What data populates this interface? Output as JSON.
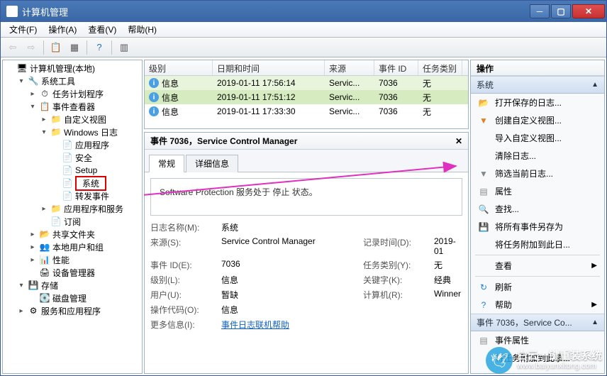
{
  "title": "计算机管理",
  "menu": [
    "文件(F)",
    "操作(A)",
    "查看(V)",
    "帮助(H)"
  ],
  "tree": [
    {
      "d": 0,
      "tw": "",
      "ic": "🖥",
      "lbl": "计算机管理(本地)"
    },
    {
      "d": 1,
      "tw": "▾",
      "ic": "🔧",
      "lbl": "系统工具"
    },
    {
      "d": 2,
      "tw": "▸",
      "ic": "⏱",
      "lbl": "任务计划程序"
    },
    {
      "d": 2,
      "tw": "▾",
      "ic": "📋",
      "lbl": "事件查看器"
    },
    {
      "d": 3,
      "tw": "▸",
      "ic": "📁",
      "lbl": "自定义视图"
    },
    {
      "d": 3,
      "tw": "▾",
      "ic": "📁",
      "lbl": "Windows 日志"
    },
    {
      "d": 4,
      "tw": "",
      "ic": "📄",
      "lbl": "应用程序"
    },
    {
      "d": 4,
      "tw": "",
      "ic": "📄",
      "lbl": "安全"
    },
    {
      "d": 4,
      "tw": "",
      "ic": "📄",
      "lbl": "Setup"
    },
    {
      "d": 4,
      "tw": "",
      "ic": "📄",
      "lbl": "系统",
      "hl": true
    },
    {
      "d": 4,
      "tw": "",
      "ic": "📄",
      "lbl": "转发事件"
    },
    {
      "d": 3,
      "tw": "▸",
      "ic": "📁",
      "lbl": "应用程序和服务"
    },
    {
      "d": 3,
      "tw": "",
      "ic": "📄",
      "lbl": "订阅"
    },
    {
      "d": 2,
      "tw": "▸",
      "ic": "📂",
      "lbl": "共享文件夹"
    },
    {
      "d": 2,
      "tw": "▸",
      "ic": "👥",
      "lbl": "本地用户和组"
    },
    {
      "d": 2,
      "tw": "▸",
      "ic": "📊",
      "lbl": "性能"
    },
    {
      "d": 2,
      "tw": "",
      "ic": "🖨",
      "lbl": "设备管理器"
    },
    {
      "d": 1,
      "tw": "▾",
      "ic": "💾",
      "lbl": "存储"
    },
    {
      "d": 2,
      "tw": "",
      "ic": "💽",
      "lbl": "磁盘管理"
    },
    {
      "d": 1,
      "tw": "▸",
      "ic": "⚙",
      "lbl": "服务和应用程序"
    }
  ],
  "list": {
    "headers": [
      "级别",
      "日期和时间",
      "来源",
      "事件 ID",
      "任务类别"
    ],
    "widths": [
      96,
      158,
      70,
      62,
      62
    ],
    "rows": [
      {
        "lvl": "信息",
        "dt": "2019-01-11 17:56:14",
        "src": "Servic...",
        "id": "7036",
        "cat": "无",
        "sel": false
      },
      {
        "lvl": "信息",
        "dt": "2019-01-11 17:51:12",
        "src": "Servic...",
        "id": "7036",
        "cat": "无",
        "sel": true
      },
      {
        "lvl": "信息",
        "dt": "2019-01-11 17:33:30",
        "src": "Servic...",
        "id": "7036",
        "cat": "无",
        "sel": false
      }
    ]
  },
  "detail": {
    "title": "事件 7036，Service Control Manager",
    "tabs": [
      "常规",
      "详细信息"
    ],
    "message": "Software Protection 服务处于 停止 状态。",
    "fields": [
      {
        "k": "日志名称(M):",
        "v": "系统",
        "k2": "",
        "v2": ""
      },
      {
        "k": "来源(S):",
        "v": "Service Control Manager",
        "k2": "记录时间(D):",
        "v2": "2019-01"
      },
      {
        "k": "事件 ID(E):",
        "v": "7036",
        "k2": "任务类别(Y):",
        "v2": "无"
      },
      {
        "k": "级别(L):",
        "v": "信息",
        "k2": "关键字(K):",
        "v2": "经典"
      },
      {
        "k": "用户(U):",
        "v": "暂缺",
        "k2": "计算机(R):",
        "v2": "Winner"
      },
      {
        "k": "操作代码(O):",
        "v": "信息",
        "k2": "",
        "v2": ""
      }
    ],
    "more_label": "更多信息(I):",
    "more_link": "事件日志联机帮助"
  },
  "actions": {
    "title": "操作",
    "section1": "系统",
    "items1": [
      {
        "ic": "📂",
        "lbl": "打开保存的日志..."
      },
      {
        "ic": "▼",
        "lbl": "创建自定义视图...",
        "col": "#e08020"
      },
      {
        "ic": "",
        "lbl": "导入自定义视图..."
      },
      {
        "ic": "",
        "lbl": "清除日志..."
      },
      {
        "ic": "▼",
        "lbl": "筛选当前日志...",
        "col": "#808890"
      },
      {
        "ic": "▤",
        "lbl": "属性"
      },
      {
        "ic": "🔍",
        "lbl": "查找..."
      },
      {
        "ic": "💾",
        "lbl": "将所有事件另存为"
      },
      {
        "ic": "",
        "lbl": "将任务附加到此日..."
      },
      {
        "div": true
      },
      {
        "ic": "",
        "lbl": "查看",
        "arrow": true
      },
      {
        "div": true
      },
      {
        "ic": "↻",
        "lbl": "刷新",
        "col": "#2080d0"
      },
      {
        "ic": "?",
        "lbl": "帮助",
        "col": "#2080d0",
        "arrow": true
      }
    ],
    "section2": "事件 7036，Service Co...",
    "items2": [
      {
        "ic": "▤",
        "lbl": "事件属性"
      },
      {
        "ic": "",
        "lbl": "将任务附加到此事..."
      }
    ]
  },
  "watermark": {
    "brand": "白云一键重装系统",
    "url": "www.baiyunxitong.com"
  }
}
